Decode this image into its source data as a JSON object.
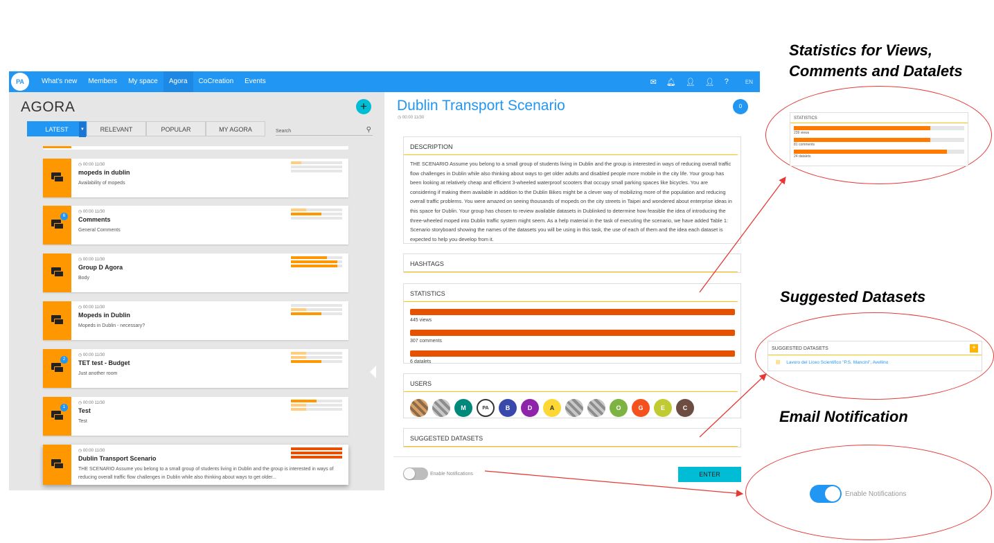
{
  "nav": {
    "logo": "PA",
    "items": [
      "What's new",
      "Members",
      "My space",
      "Agora",
      "CoCreation",
      "Events"
    ],
    "active": "Agora",
    "lang": "EN",
    "icons": [
      "mail-icon",
      "bell-icon",
      "user-icon",
      "profile-icon",
      "help-icon"
    ]
  },
  "agora": {
    "title": "AGORA",
    "plus": "+",
    "tabs": [
      "LATEST",
      "RELEVANT",
      "POPULAR",
      "MY AGORA"
    ],
    "search_label": "Search",
    "cards": [
      {
        "time": "00:00 11/30",
        "title": "mopeds in dublin",
        "desc": "Availability of mopeds",
        "badge": "",
        "bars": [
          0.2,
          0.0,
          0.0
        ]
      },
      {
        "time": "00:00 11/30",
        "title": "Comments",
        "desc": "General Comments",
        "badge": "6",
        "bars": [
          0.3,
          0.6,
          0.0
        ]
      },
      {
        "time": "00:00 11/30",
        "title": "Group D Agora",
        "desc": "Body",
        "badge": "",
        "bars": [
          0.7,
          0.9,
          0.9
        ]
      },
      {
        "time": "00:00 11/30",
        "title": "Mopeds in Dublin",
        "desc": "Mopeds in Dublin - necessary?",
        "badge": "",
        "bars": [
          0.0,
          0.3,
          0.6
        ]
      },
      {
        "time": "00:00 11/30",
        "title": "TET test - Budget",
        "desc": "Just another room",
        "badge": "2",
        "bars": [
          0.3,
          0.3,
          0.6
        ]
      },
      {
        "time": "00:00 11/30",
        "title": "Test",
        "desc": "Test",
        "badge": "1",
        "bars": [
          0.5,
          0.3,
          0.3
        ]
      },
      {
        "time": "00:00 11/30",
        "title": "Dublin Transport Scenario",
        "desc": "THE SCENARIO Assume you belong to a small group of students living in Dublin and the group is interested in ways of reducing overall traffic flow challenges in Dublin while also thinking about ways to get older...",
        "badge": "",
        "bars": [
          1.0,
          1.0,
          1.0
        ]
      }
    ]
  },
  "detail": {
    "title": "Dublin Transport Scenario",
    "time": "00:00 11/30",
    "badge": "0",
    "description_head": "DESCRIPTION",
    "description": "THE SCENARIO Assume you belong to a small group of students living in Dublin and the group is interested in ways of reducing overall traffic flow challenges in Dublin while also thinking about ways to get older adults and disabled people more mobile in the city life. Your group has been looking at relatively cheap and efficient 3-wheeled waterproof scooters that occupy small parking spaces like bicycles. You are considering if making them available in addition to the Dublin Bikes might be a clever way of mobilizing more of the population and reducing overall traffic problems. You were amazed on seeing thousands of mopeds on the city streets in Taipei and wondered about enterprise ideas in this space for Dublin. Your group has chosen to review available datasets in Dublinked to determine how feasible the idea of introducing the three-wheeled moped into Dublin traffic system might seem. As a help material in the task of executing the scenario, we have added Table 1: Scenario storyboard showing the names of the datasets you will be using in this task, the use of each of them and the idea each dataset is expected to help you develop from it.",
    "hashtags_head": "HASHTAGS",
    "statistics_head": "STATISTICS",
    "stats": [
      {
        "label": "445 views",
        "fill": 1.0
      },
      {
        "label": "307 comments",
        "fill": 1.0
      },
      {
        "label": "6 datalets",
        "fill": 1.0
      }
    ],
    "users_head": "USERS",
    "users": [
      {
        "letter": "",
        "color": "px1"
      },
      {
        "letter": "",
        "color": "px"
      },
      {
        "letter": "M",
        "color": "#00897b"
      },
      {
        "letter": "PA",
        "color": "pa"
      },
      {
        "letter": "B",
        "color": "#3949ab"
      },
      {
        "letter": "D",
        "color": "#8e24aa"
      },
      {
        "letter": "A",
        "color": "#fdd835"
      },
      {
        "letter": "",
        "color": "px"
      },
      {
        "letter": "",
        "color": "px"
      },
      {
        "letter": "O",
        "color": "#7cb342"
      },
      {
        "letter": "G",
        "color": "#f4511e"
      },
      {
        "letter": "E",
        "color": "#c0ca33"
      },
      {
        "letter": "C",
        "color": "#6d4c41"
      }
    ],
    "suggested_head": "SUGGESTED DATASETS",
    "notifications_label": "Enable Notifications",
    "enter_label": "ENTER"
  },
  "annotations": {
    "stats_heading_1": "Statistics for Views,",
    "stats_heading_2": "Comments and Datalets",
    "datasets_heading": "Suggested Datasets",
    "email_heading": "Email Notification",
    "mini_stats": {
      "head": "STATISTICS",
      "items": [
        {
          "label": "239 views",
          "fill": 0.8
        },
        {
          "label": "81 comments",
          "fill": 0.8
        },
        {
          "label": "24 datalets",
          "fill": 0.9
        }
      ]
    },
    "mini_datasets": {
      "head": "SUGGESTED DATASETS",
      "plus": "+",
      "item": "Lavoro del Liceo Scientifico \"P.S. Mancini\", Avellino"
    },
    "mini_toggle_label": "Enable Notifications"
  }
}
